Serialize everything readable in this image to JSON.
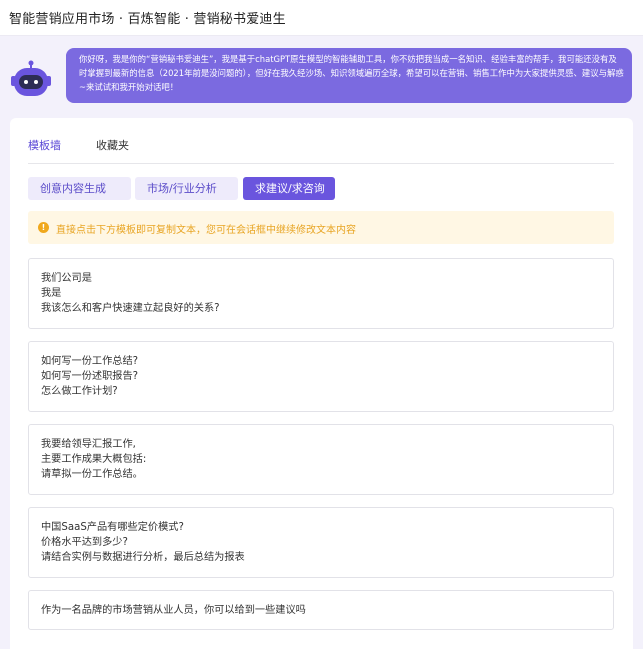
{
  "header": {
    "title": "智能营销应用市场 · 百炼智能 · 营销秘书爱迪生"
  },
  "intro": {
    "avatar_icon": "robot-icon",
    "message": "你好呀，我是你的“营销秘书爱迪生”，我是基于chatGPT原生模型的智能辅助工具，你不妨把我当成一名知识、经验丰富的帮手，我可能还没有及时掌握到最新的信息（2021年前是没问题的），但好在我久经沙场、知识领域遍历全球，希望可以在营销、销售工作中为大家提供灵感、建议与解惑~来试试和我开始对话吧！"
  },
  "tabs": [
    {
      "label": "模板墙",
      "active": true
    },
    {
      "label": "收藏夹",
      "active": false
    }
  ],
  "categories": [
    {
      "label": "创意内容生成",
      "selected": false
    },
    {
      "label": "市场/行业分析",
      "selected": false
    },
    {
      "label": "求建议/求咨询",
      "selected": true
    }
  ],
  "notice": {
    "icon": "exclamation-icon",
    "text": "直接点击下方模板即可复制文本，您可在会话框中继续修改文本内容",
    "color": "#e8a524"
  },
  "templates": [
    {
      "lines": [
        "我们公司是",
        "我是",
        "我该怎么和客户快速建立起良好的关系?"
      ]
    },
    {
      "lines": [
        "如何写一份工作总结?",
        "如何写一份述职报告?",
        "怎么做工作计划?"
      ]
    },
    {
      "lines": [
        "我要给领导汇报工作,",
        "主要工作成果大概包括:",
        "请草拟一份工作总结。"
      ]
    },
    {
      "lines": [
        "中国SaaS产品有哪些定价模式?",
        "价格水平达到多少?",
        "请结合实例与数据进行分析，最后总结为报表"
      ]
    },
    {
      "lines": [
        "作为一名品牌的市场营销从业人员，你可以给到一些建议吗"
      ]
    }
  ],
  "colors": {
    "accent": "#6a55de",
    "bubble": "#7b6ae0",
    "background": "#f3f1fb"
  }
}
